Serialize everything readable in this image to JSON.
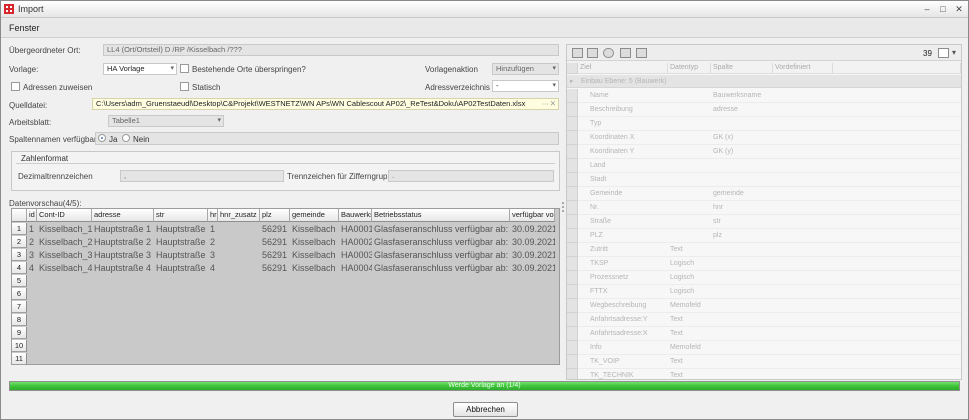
{
  "window": {
    "title": "Import"
  },
  "menu": {
    "items": [
      "Fenster"
    ]
  },
  "form": {
    "parent_label": "Übergeordneter Ort:",
    "parent_value": "LL4 (Ort/Ortsteil) D /RP /Kisselbach /???",
    "template_label": "Vorlage:",
    "template_value": "HA Vorlage",
    "skip_existing_label": "Bestehende Orte überspringen?",
    "template_action_label": "Vorlagenaktion",
    "template_action_value": "Hinzufügen",
    "assign_addresses_label": "Adressen zuweisen",
    "static_label": "Statisch",
    "address_dir_label": "Adressverzeichnis",
    "address_dir_value": "-",
    "source_label": "Quelldatei:",
    "source_value": "C:\\Users\\adm_Gruenstaeudl\\Desktop\\C&Projekt\\WESTNETZ\\WN APs\\WN Cablescout AP02\\_ReTest&Doku\\AP02TestDaten.xlsx",
    "sheet_label": "Arbeitsblatt:",
    "sheet_value": "Tabelle1",
    "colnames_label": "Spaltennamen verfügbar?",
    "yes_label": "Ja",
    "no_label": "Nein",
    "numfmt_title": "Zahlenformat",
    "decimal_label": "Dezimaltrennzeichen",
    "decimal_value": ",",
    "thousand_label": "Trennzeichen für Zifferngruppe",
    "thousand_value": "."
  },
  "preview": {
    "label": "Datenvorschau(4/5):",
    "columns": [
      "id",
      "Cont-ID",
      "adresse",
      "str",
      "hr",
      "hnr_zusatz",
      "plz",
      "gemeinde",
      "Bauwerks",
      "Betriebsstatus",
      "verfügbar von"
    ],
    "rows": [
      [
        "1",
        "Kisselbach_1",
        "Hauptstraße 1",
        "Hauptstraße",
        "1",
        "",
        "56291",
        "Kisselbach",
        "HA0001",
        "Glasfaseranschluss verfügbar ab:",
        "30.09.2021"
      ],
      [
        "2",
        "Kisselbach_2",
        "Hauptstraße 2",
        "Hauptstraße",
        "2",
        "",
        "56291",
        "Kisselbach",
        "HA0002",
        "Glasfaseranschluss verfügbar ab:",
        "30.09.2021"
      ],
      [
        "3",
        "Kisselbach_3",
        "Hauptstraße 3",
        "Hauptstraße",
        "3",
        "",
        "56291",
        "Kisselbach",
        "HA0003",
        "Glasfaseranschluss verfügbar ab:",
        "30.09.2021"
      ],
      [
        "4",
        "Kisselbach_4",
        "Hauptstraße 4",
        "Hauptstraße",
        "4",
        "",
        "56291",
        "Kisselbach",
        "HA0004",
        "Glasfaseranschluss verfügbar ab:",
        "30.09.2021"
      ]
    ],
    "row_numbers": [
      "1",
      "2",
      "3",
      "4",
      "5",
      "6",
      "7",
      "8",
      "9",
      "10",
      "11"
    ]
  },
  "mapping": {
    "count": "39",
    "columns": [
      "Ziel",
      "Datentyp",
      "Spalte",
      "Vordefiniert"
    ],
    "group_title": "Einbau Ebene: 5 (Bauwerk)",
    "rows": [
      [
        "Name",
        "",
        "Bauwerksname"
      ],
      [
        "Beschreibung",
        "",
        "adresse"
      ],
      [
        "Typ",
        "",
        ""
      ],
      [
        "Koordinaten X",
        "",
        "GK (x)"
      ],
      [
        "Koordinaten Y",
        "",
        "GK (y)"
      ],
      [
        "Land",
        "",
        ""
      ],
      [
        "Stadt",
        "",
        ""
      ],
      [
        "Gemeinde",
        "",
        "gemeinde"
      ],
      [
        "Nr.",
        "",
        "hnr"
      ],
      [
        "Straße",
        "",
        "str"
      ],
      [
        "PLZ",
        "",
        "plz"
      ],
      [
        "Zutritt",
        "Text",
        ""
      ],
      [
        "TKSP",
        "Logisch",
        ""
      ],
      [
        "Prozessnetz",
        "Logisch",
        ""
      ],
      [
        "FTTX",
        "Logisch",
        ""
      ],
      [
        "Wegbeschreibung",
        "Memofeld",
        ""
      ],
      [
        "Anfahrtsadresse:Y",
        "Text",
        ""
      ],
      [
        "Anfahrtsadresse:X",
        "Text",
        ""
      ],
      [
        "Info",
        "Memofeld",
        ""
      ],
      [
        "TK_VOIP",
        "Text",
        ""
      ],
      [
        "TK_TECHNIK",
        "Text",
        ""
      ]
    ]
  },
  "progress": {
    "text": "Werde Vorlage an (1/4)",
    "fraction": 1.0,
    "color": "#3ec43a"
  },
  "buttons": {
    "cancel": "Abbrechen"
  }
}
